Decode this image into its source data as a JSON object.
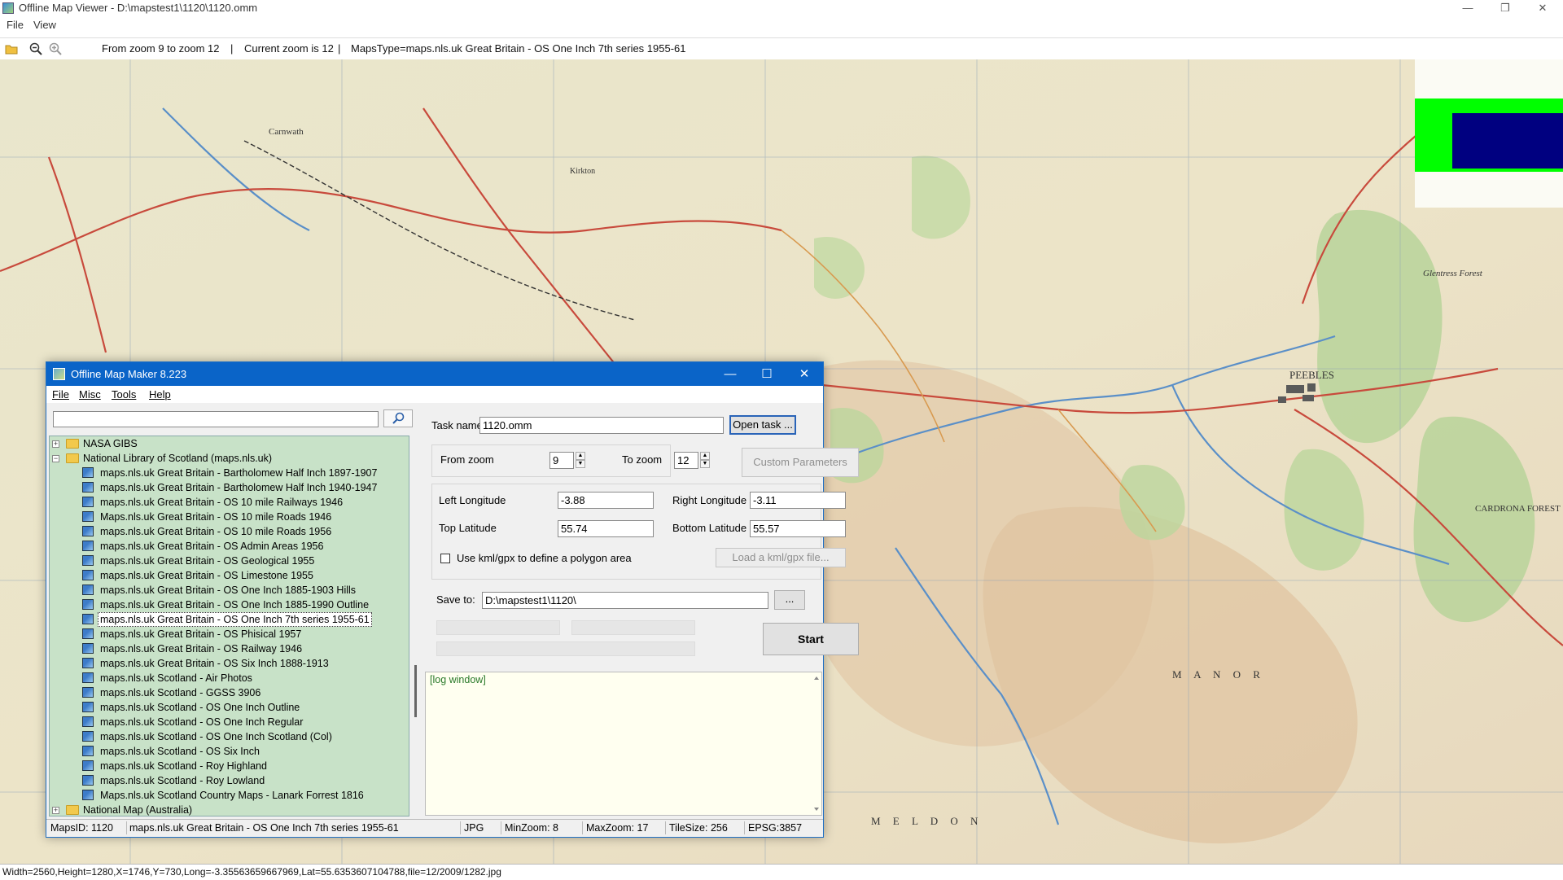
{
  "window": {
    "title": "Offline Map Viewer - D:\\mapstest1\\1120\\1120.omm",
    "controls": {
      "minimize": "—",
      "maximize": "❐",
      "close": "✕"
    }
  },
  "menu": {
    "file": "File",
    "view": "View"
  },
  "toolbar": {
    "zoom_range": "From zoom 9 to zoom 12",
    "sep1": "|",
    "current_zoom": "Current zoom is 12",
    "sep2": "|",
    "maps_type": "MapsType=maps.nls.uk Great Britain - OS One Inch 7th series 1955-61"
  },
  "status_bar": {
    "text": "Width=2560,Height=1280,X=1746,Y=730,Long=-3.35563659667969,Lat=55.6353607104788,file=12/2009/1282.jpg"
  },
  "map": {
    "labels": [
      "PEEBLES",
      "Glentress Forest",
      "CARDRONA FOREST",
      "M A N O R",
      "M E L D O N",
      "Kirkton",
      "Carnwath"
    ]
  },
  "dialog": {
    "title": "Offline Map Maker 8.223",
    "controls": {
      "minimize": "—",
      "maximize": "☐",
      "close": "✕"
    },
    "menu": {
      "file": "File",
      "misc": "Misc",
      "tools": "Tools",
      "help": "Help"
    },
    "search": {
      "value": "",
      "button_icon": "search-icon"
    },
    "tree": {
      "top_groups": [
        "NASA GIBS",
        "National Library of Scotland (maps.nls.uk)"
      ],
      "items": [
        "maps.nls.uk Great Britain - Bartholomew Half Inch 1897-1907",
        "maps.nls.uk Great Britain - Bartholomew Half Inch 1940-1947",
        "maps.nls.uk Great Britain - OS 10 mile Railways 1946",
        "Maps.nls.uk Great Britain - OS 10 mile Roads 1946",
        "maps.nls.uk Great Britain - OS 10 mile Roads 1956",
        "maps.nls.uk Great Britain - OS Admin Areas 1956",
        "maps.nls.uk Great Britain - OS Geological 1955",
        "maps.nls.uk Great Britain - OS Limestone 1955",
        "maps.nls.uk Great Britain - OS One Inch 1885-1903 Hills",
        "maps.nls.uk Great Britain - OS One Inch 1885-1990 Outline",
        "maps.nls.uk Great Britain - OS One Inch 7th series 1955-61",
        "maps.nls.uk Great Britain - OS Phisical 1957",
        "maps.nls.uk Great Britain - OS Railway 1946",
        "maps.nls.uk Great Britain - OS Six Inch 1888-1913",
        "maps.nls.uk Scotland - Air Photos",
        "maps.nls.uk Scotland - GGSS 3906",
        "maps.nls.uk Scotland - OS One Inch Outline",
        "maps.nls.uk Scotland - OS One Inch Regular",
        "maps.nls.uk Scotland - OS One Inch Scotland (Col)",
        "maps.nls.uk Scotland - OS Six Inch",
        "maps.nls.uk Scotland - Roy Highland",
        "maps.nls.uk Scotland - Roy Lowland",
        "Maps.nls.uk Scotland Country Maps - Lanark Forrest 1816"
      ],
      "bottom_group": "National Map (Australia)",
      "selected_index": 10
    },
    "form": {
      "task_name_label": "Task name",
      "task_name_value": "1120.omm",
      "open_task": "Open task ...",
      "from_zoom_label": "From zoom",
      "from_zoom_value": "9",
      "to_zoom_label": "To zoom",
      "to_zoom_value": "12",
      "custom_params": "Custom Parameters",
      "left_lon_label": "Left Longitude",
      "left_lon_value": "-3.88",
      "right_lon_label": "Right Longitude",
      "right_lon_value": "-3.11",
      "top_lat_label": "Top Latitude",
      "top_lat_value": "55.74",
      "bottom_lat_label": "Bottom Latitude",
      "bottom_lat_value": "55.57",
      "use_kml_label": "Use kml/gpx to define a polygon area",
      "load_kml": "Load a kml/gpx file...",
      "save_to_label": "Save to:",
      "save_to_value": "D:\\mapstest1\\1120\\",
      "browse": "...",
      "start": "Start"
    },
    "log": {
      "text": "[log window]"
    },
    "status": {
      "maps_id": "MapsID: 1120",
      "maps_name": "maps.nls.uk Great Britain - OS One Inch 7th series 1955-61",
      "format": "JPG",
      "min_zoom": "MinZoom: 8",
      "max_zoom": "MaxZoom: 17",
      "tile_size": "TileSize: 256",
      "epsg": "EPSG:3857"
    }
  }
}
